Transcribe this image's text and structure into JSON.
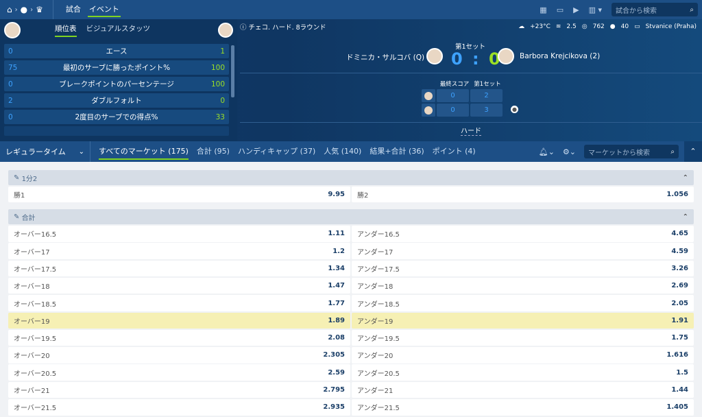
{
  "topbar": {
    "home_icon": "home-icon",
    "sport_icon": "tennis-ball-icon",
    "trophy_icon": "trophy-icon",
    "nav": [
      "試合",
      "イベント"
    ],
    "search_placeholder": "試合から検索",
    "accent": "#7fd321"
  },
  "stats": {
    "tabs": [
      "順位表",
      "ビジュアルスタッツ"
    ],
    "rows": [
      {
        "left": "0",
        "label": "エース",
        "right": "1"
      },
      {
        "left": "75",
        "label": "最初のサーブに勝ったポイント%",
        "right": "100"
      },
      {
        "left": "0",
        "label": "ブレークポイントのパーセンテージ",
        "right": "100"
      },
      {
        "left": "2",
        "label": "ダブルフォルト",
        "right": "0"
      },
      {
        "left": "0",
        "label": "2度目のサーブでの得点%",
        "right": "33"
      }
    ]
  },
  "match": {
    "info": "チェコ. ハード. 8ラウンド",
    "weather": {
      "temp": "+23°C",
      "wind": "2.5",
      "pressure": "762",
      "humidity": "40",
      "venue": "Stvanice (Praha)"
    },
    "set_label": "第1セット",
    "player1": "ドミニカ・サルコバ (Q)",
    "player2": "Barbora Krejcikova (2)",
    "score1": "0",
    "score2": "0",
    "table_headers": [
      "最終スコア",
      "第1セット"
    ],
    "table_rows": [
      [
        "0",
        "2"
      ],
      [
        "0",
        "3"
      ]
    ],
    "surface": "ハード"
  },
  "market_bar": {
    "dropdown": "レギュラータイム",
    "tabs": [
      "すべてのマーケット (175)",
      "合計 (95)",
      "ハンディキャップ (37)",
      "人気 (140)",
      "結果+合計 (36)",
      "ポイント (4)"
    ],
    "search_placeholder": "マーケットから検索"
  },
  "sections": {
    "winner": {
      "title": "1分2",
      "rows": [
        {
          "l": "勝1",
          "lv": "9.95",
          "r": "勝2",
          "rv": "1.056"
        }
      ]
    },
    "total": {
      "title": "合計",
      "rows": [
        {
          "l": "オーバー16.5",
          "lv": "1.11",
          "r": "アンダー16.5",
          "rv": "4.65"
        },
        {
          "l": "オーバー17",
          "lv": "1.2",
          "r": "アンダー17",
          "rv": "4.59"
        },
        {
          "l": "オーバー17.5",
          "lv": "1.34",
          "r": "アンダー17.5",
          "rv": "3.26"
        },
        {
          "l": "オーバー18",
          "lv": "1.47",
          "r": "アンダー18",
          "rv": "2.69"
        },
        {
          "l": "オーバー18.5",
          "lv": "1.77",
          "r": "アンダー18.5",
          "rv": "2.05"
        },
        {
          "l": "オーバー19",
          "lv": "1.89",
          "r": "アンダー19",
          "rv": "1.91"
        },
        {
          "l": "オーバー19.5",
          "lv": "2.08",
          "r": "アンダー19.5",
          "rv": "1.75"
        },
        {
          "l": "オーバー20",
          "lv": "2.305",
          "r": "アンダー20",
          "rv": "1.616"
        },
        {
          "l": "オーバー20.5",
          "lv": "2.59",
          "r": "アンダー20.5",
          "rv": "1.5"
        },
        {
          "l": "オーバー21",
          "lv": "2.795",
          "r": "アンダー21",
          "rv": "1.44"
        },
        {
          "l": "オーバー21.5",
          "lv": "2.935",
          "r": "アンダー21.5",
          "rv": "1.405"
        }
      ]
    }
  }
}
